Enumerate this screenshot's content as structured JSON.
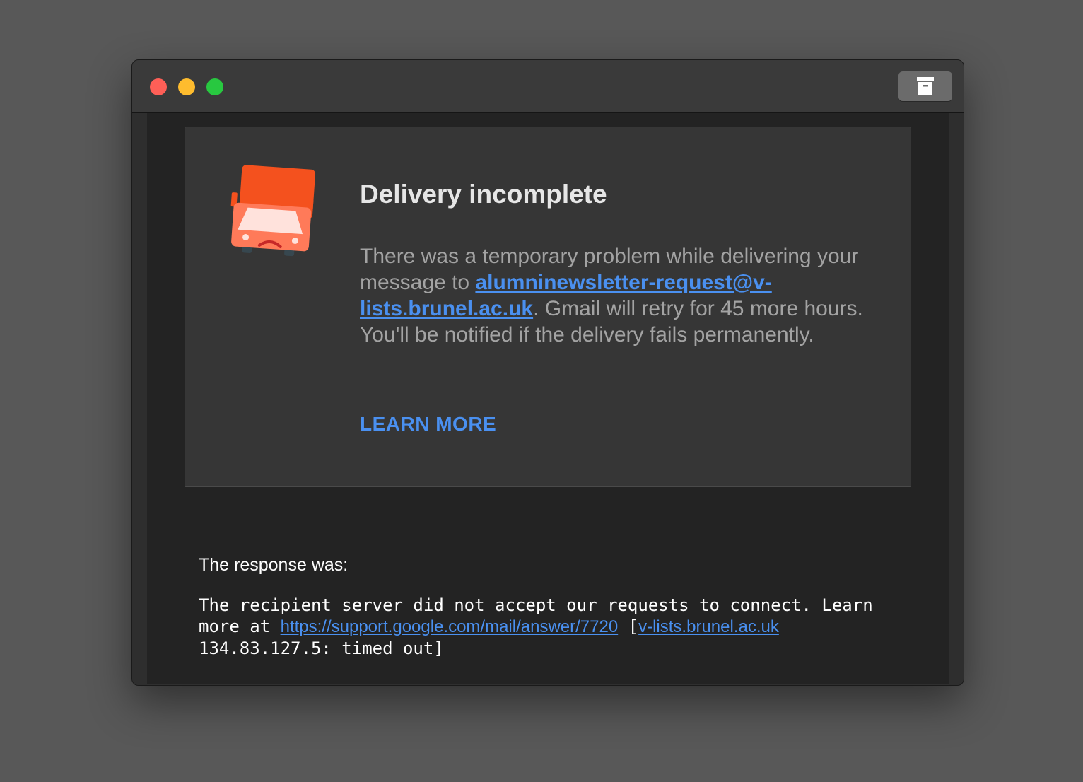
{
  "window": {
    "controls": {
      "close": "close-button",
      "minimize": "minimize-button",
      "maximize": "zoom-button"
    },
    "toolbar": {
      "archive_icon": "archive-icon"
    }
  },
  "card": {
    "icon": "sad-truck-icon",
    "title": "Delivery incomplete",
    "body_before_link": "There was a temporary problem while delivering your message to ",
    "recipient": "alumninewsletter-request@v-lists.brunel.ac.uk",
    "body_after_link": ". Gmail will retry for 45 more hours. You'll be notified if the delivery fails permanently.",
    "learn_more": "LEARN MORE"
  },
  "response": {
    "label": "The response was:",
    "text_before_url": "The recipient server did not accept our requests to connect. Learn more at ",
    "support_url": "https://support.google.com/mail/answer/7720",
    "text_open_bracket": " [",
    "host_link": "v-lists.brunel.ac.uk",
    "text_after_host": " 134.83.127.5: timed out]"
  },
  "colors": {
    "background": "#585858",
    "window_bg": "#232323",
    "card_bg": "#363636",
    "link": "#4a90f0",
    "truck": "#f4511e"
  }
}
